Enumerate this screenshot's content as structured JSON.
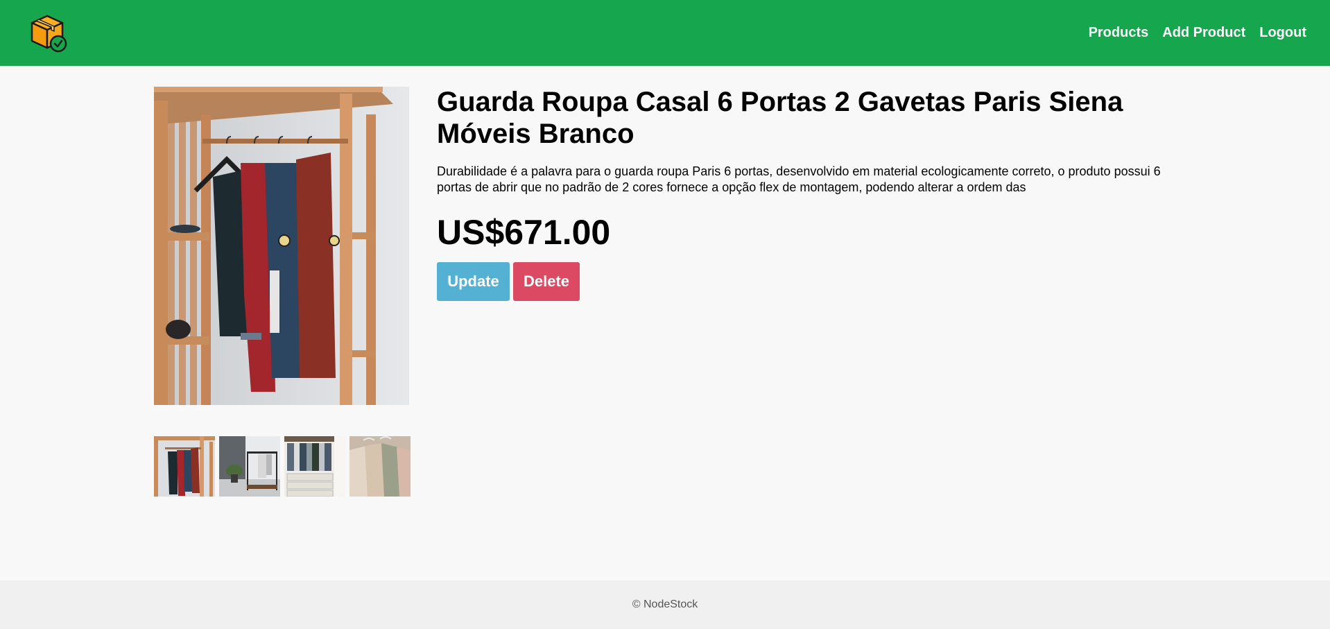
{
  "header": {
    "logo_icon": "package-check-icon",
    "nav": [
      {
        "label": "Products"
      },
      {
        "label": "Add Product"
      },
      {
        "label": "Logout"
      }
    ]
  },
  "product": {
    "title": "Guarda Roupa Casal 6 Portas 2 Gavetas Paris Siena Móveis Branco",
    "description": "Durabilidade é a palavra para o guarda roupa Paris 6 portas, desenvolvido em material ecologicamente correto, o produto possui 6 portas de abrir que no padrão de 2 cores fornece a opção flex de montagem, podendo alterar a ordem das",
    "price": "US$671.00",
    "main_image": "wooden-wardrobe-rack-with-jackets",
    "thumbnails": [
      "wooden-wardrobe-rack-with-jackets",
      "metal-clothing-rack-with-plant",
      "closet-with-drawers-and-shirts",
      "hanging-sweaters-closeup"
    ]
  },
  "actions": {
    "update_label": "Update",
    "delete_label": "Delete"
  },
  "footer": {
    "text": "© NodeStock"
  },
  "colors": {
    "navbar": "#16a64d",
    "update_button": "#55b1d3",
    "delete_button": "#dc4963",
    "background": "#f8f8f8",
    "footer_background": "#f0f0f0"
  }
}
